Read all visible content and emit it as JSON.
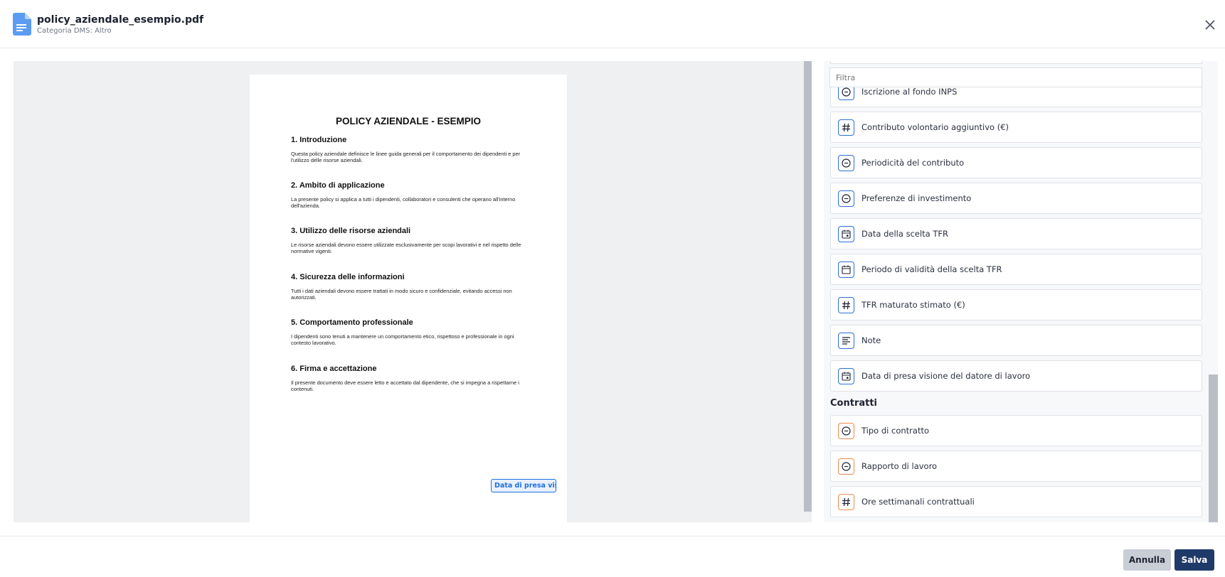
{
  "header": {
    "file_name": "policy_aziendale_esempio.pdf",
    "category": "Categoria DMS: Altro"
  },
  "document": {
    "title": "POLICY AZIENDALE - ESEMPIO",
    "sections": [
      {
        "heading": "1. Introduzione",
        "body": "Questa policy aziendale definisce le linee guida generali per il comportamento dei dipendenti e per l'utilizzo delle risorse aziendali."
      },
      {
        "heading": "2. Ambito di applicazione",
        "body": "La presente policy si applica a tutti i dipendenti, collaboratori e consulenti che operano all'interno dell'azienda."
      },
      {
        "heading": "3. Utilizzo delle risorse aziendali",
        "body": "Le risorse aziendali devono essere utilizzate esclusivamente per scopi lavorativi e nel rispetto delle normative vigenti."
      },
      {
        "heading": "4. Sicurezza delle informazioni",
        "body": "Tutti i dati aziendali devono essere trattati in modo sicuro e confidenziale, evitando accessi non autorizzati."
      },
      {
        "heading": "5. Comportamento professionale",
        "body": "I dipendenti sono tenuti a mantenere un comportamento etico, rispettoso e professionale in ogni contesto lavorativo."
      },
      {
        "heading": "6. Firma e accettazione",
        "body": "Il presente documento deve essere letto e accettato dal dipendente, che si impegna a rispettarne i contenuti."
      }
    ],
    "placed_field": "Data di presa vis..."
  },
  "panel": {
    "filter_placeholder": "Filtra",
    "fields": [
      {
        "label": "Iscrizione al fondo INPS",
        "icon": "select-circle-icon"
      },
      {
        "label": "Contributo volontario aggiuntivo (€)",
        "icon": "hash-icon"
      },
      {
        "label": "Periodicità del contributo",
        "icon": "select-circle-icon"
      },
      {
        "label": "Preferenze di investimento",
        "icon": "select-circle-icon"
      },
      {
        "label": "Data della scelta TFR",
        "icon": "calendar-day-icon"
      },
      {
        "label": "Periodo di validità della scelta TFR",
        "icon": "calendar-icon"
      },
      {
        "label": "TFR maturato stimato (€)",
        "icon": "hash-icon"
      },
      {
        "label": "Note",
        "icon": "text-lines-icon"
      },
      {
        "label": "Data di presa visione del datore di lavoro",
        "icon": "calendar-day-icon"
      }
    ],
    "group_contratti": {
      "title": "Contratti",
      "fields": [
        {
          "label": "Tipo di contratto",
          "icon": "select-circle-icon"
        },
        {
          "label": "Rapporto di lavoro",
          "icon": "select-circle-icon"
        },
        {
          "label": "Ore settimanali contrattuali",
          "icon": "hash-icon"
        }
      ]
    }
  },
  "footer": {
    "cancel_label": "Annulla",
    "save_label": "Salva"
  },
  "colors": {
    "primary": "#2c6fd6",
    "contract_accent": "#f08a4b",
    "save_button": "#1f3a68",
    "cancel_button": "#c9ced6"
  }
}
